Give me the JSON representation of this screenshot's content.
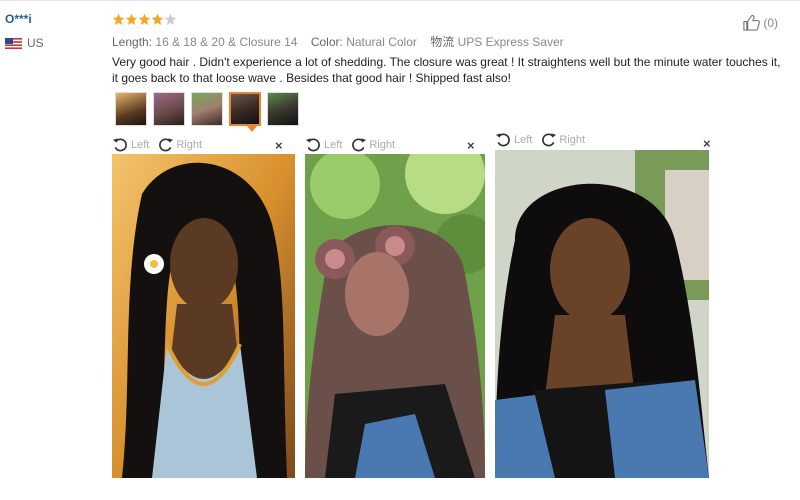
{
  "reviewer": {
    "name": "O***i",
    "country": "US"
  },
  "rating": {
    "value": 4,
    "max": 5
  },
  "attributes": [
    {
      "label": "Length:",
      "value": "16 & 18 & 20 & Closure 14"
    },
    {
      "label": "Color:",
      "value": "Natural Color"
    },
    {
      "label": "物流",
      "value": "UPS Express Saver"
    }
  ],
  "helpful": {
    "count_text": "(0)"
  },
  "review_text": "Very good hair . Didn't experience a lot of shedding. The closure was great ! It straightens well but the minute water touches it, it goes back to that loose wave . Besides that good hair ! Shipped fast also!",
  "thumbnails": {
    "count": 5,
    "selected_index": 3
  },
  "viewer": {
    "rotate_left": "Left",
    "rotate_right": "Right",
    "close": "×"
  },
  "colors": {
    "accent": "#e88432",
    "star": "#f5a623",
    "star_empty": "#cccccc",
    "user": "#2a5a96"
  }
}
